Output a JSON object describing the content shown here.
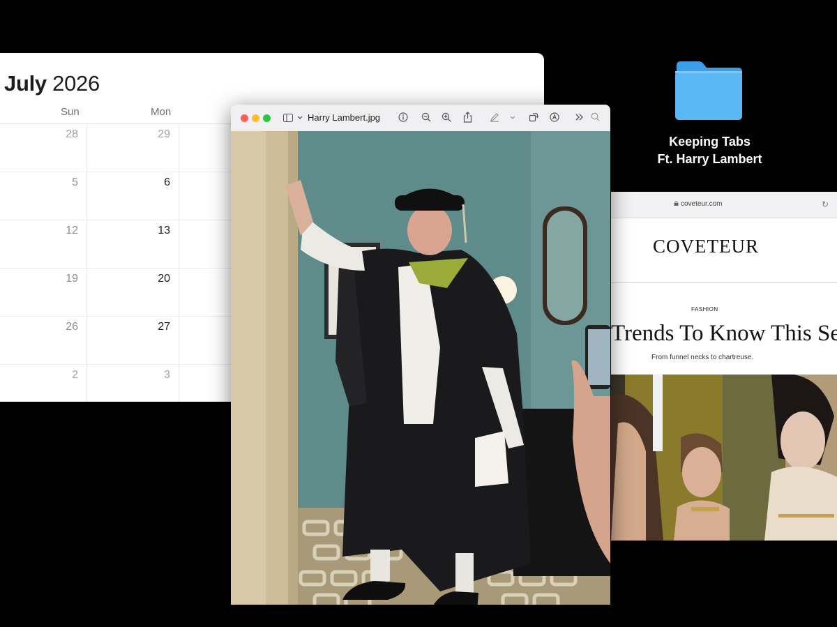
{
  "calendar": {
    "month": "July",
    "year": "2026",
    "weekdays": [
      "Sun",
      "Mon"
    ],
    "rows": [
      [
        "28",
        "29"
      ],
      [
        "5",
        "6"
      ],
      [
        "12",
        "13"
      ],
      [
        "19",
        "20"
      ],
      [
        "26",
        "27"
      ],
      [
        "2",
        "3"
      ]
    ]
  },
  "desktop": {
    "folder_line1": "Keeping Tabs",
    "folder_line2": "Ft. Harry Lambert",
    "folder_color": "#5ab8f5"
  },
  "preview": {
    "filename": "Harry Lambert.jpg",
    "toolbar_icons": [
      "sidebar-icon",
      "info-icon",
      "zoom-out-icon",
      "zoom-in-icon",
      "share-icon",
      "markup-icon",
      "rotate-icon",
      "annotate-icon",
      "more-icon",
      "search-icon"
    ]
  },
  "browser": {
    "url": "coveteur.com",
    "logo": "COVETEUR",
    "kicker": "FASHION",
    "headline": "Trends To Know This Se",
    "subhead": "From funnel necks to chartreuse."
  }
}
